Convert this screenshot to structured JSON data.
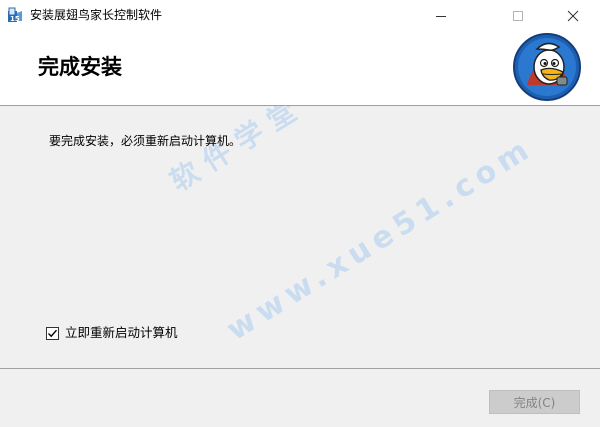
{
  "window": {
    "title": "安装展翅鸟家长控制软件",
    "controls": {
      "minimize": "minimize-icon",
      "maximize": "maximize-icon",
      "close": "close-icon"
    }
  },
  "header": {
    "title": "完成安装",
    "logo_icon": "eagle-mascot-icon"
  },
  "content": {
    "message": "要完成安装，必须重新启动计算机。",
    "restart_checkbox": {
      "label": "立即重新启动计算机",
      "checked": true
    }
  },
  "watermark": {
    "line1": "www.xue51.com",
    "line2": "软件学堂"
  },
  "footer": {
    "finish_label": "完成(C)",
    "finish_enabled": false
  },
  "colors": {
    "content_bg": "#f0f0f0",
    "separator": "#a0a0a0",
    "watermark": "#c9dcf0",
    "button_disabled_bg": "#cccccc",
    "button_disabled_text": "#838383"
  }
}
